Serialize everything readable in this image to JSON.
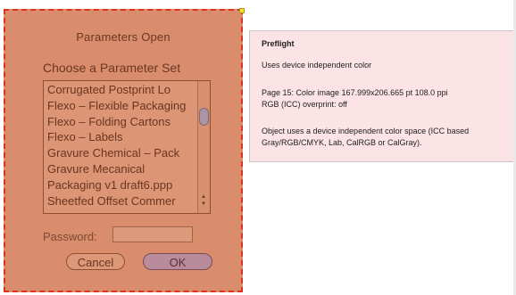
{
  "dialog": {
    "title": "Parameters Open",
    "choose_label": "Choose a Parameter Set",
    "parameter_sets": [
      "Corrugated Postprint Lo",
      "Flexo – Flexible Packaging",
      "Flexo – Folding Cartons",
      "Flexo – Labels",
      "Gravure Chemical – Pack",
      "Gravure Mecanical",
      "Packaging v1 draft6.ppp",
      "Sheetfed Offset Commer"
    ],
    "password_label": "Password:",
    "password_value": "",
    "cancel_label": "Cancel",
    "ok_label": "OK",
    "tint_color": "#d98d6d",
    "selection_border_color": "#e2301f"
  },
  "tooltip": {
    "title": "Preflight",
    "line1": "Uses device independent color",
    "line2": "Page 15: Color image 167.999x206.665 pt 108.0 ppi",
    "line3": "RGB (ICC)  overprint: off",
    "line4": "Object uses a device independent color space (ICC based",
    "line5": "Gray/RGB/CMYK, Lab, CalRGB or CalGray).",
    "background_color": "#fbe3e6"
  }
}
